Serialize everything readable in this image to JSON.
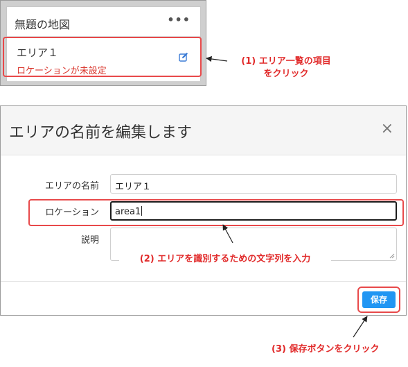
{
  "map_panel": {
    "title": "無題の地図",
    "menu_icon": "•••",
    "area_item": {
      "name": "エリア１",
      "status": "ロケーションが未設定"
    }
  },
  "annotations": {
    "step1_line1": "(1) エリア一覧の項目",
    "step1_line2": "をクリック",
    "step2": "(2) エリアを識別するための文字列を入力",
    "step3": "(3) 保存ボタンをクリック"
  },
  "modal": {
    "title": "エリアの名前を編集します",
    "close": "×",
    "fields": {
      "name_label": "エリアの名前",
      "name_value": "エリア１",
      "location_label": "ロケーション",
      "location_value": "area1",
      "description_label": "説明",
      "description_value": ""
    },
    "save_label": "保存"
  },
  "colors": {
    "accent_red": "#e12a2a",
    "primary_blue": "#2196f3"
  }
}
